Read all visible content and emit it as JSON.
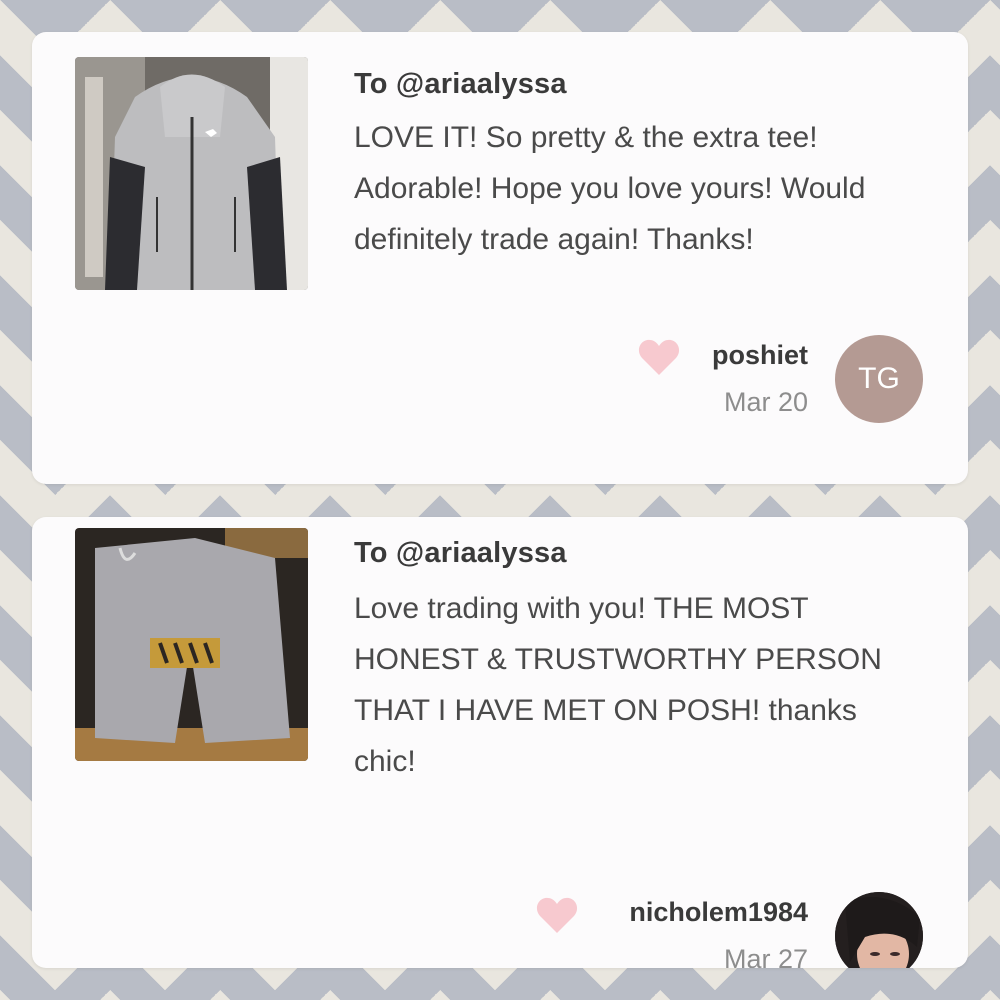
{
  "reviews": [
    {
      "recipient": "To @ariaalyssa",
      "comment": "LOVE IT! So pretty & the extra tee! Adorable! Hope you love yours! Would definitely trade again! Thanks!",
      "username": "poshiet",
      "date": "Mar 20",
      "avatar_initials": "TG",
      "avatar_color": "#b49a93",
      "image_icon": "gray-zip-hoodie-photo"
    },
    {
      "recipient": "To @ariaalyssa",
      "comment": "Love trading with you! THE MOST HONEST & TRUSTWORTHY PERSON THAT I HAVE MET ON POSH! thanks chic!",
      "username": "nicholem1984",
      "date": "Mar 27",
      "avatar_icon": "profile-photo",
      "image_icon": "gray-sweatpants-photo"
    }
  ],
  "heart_color": "#f7c9cf"
}
